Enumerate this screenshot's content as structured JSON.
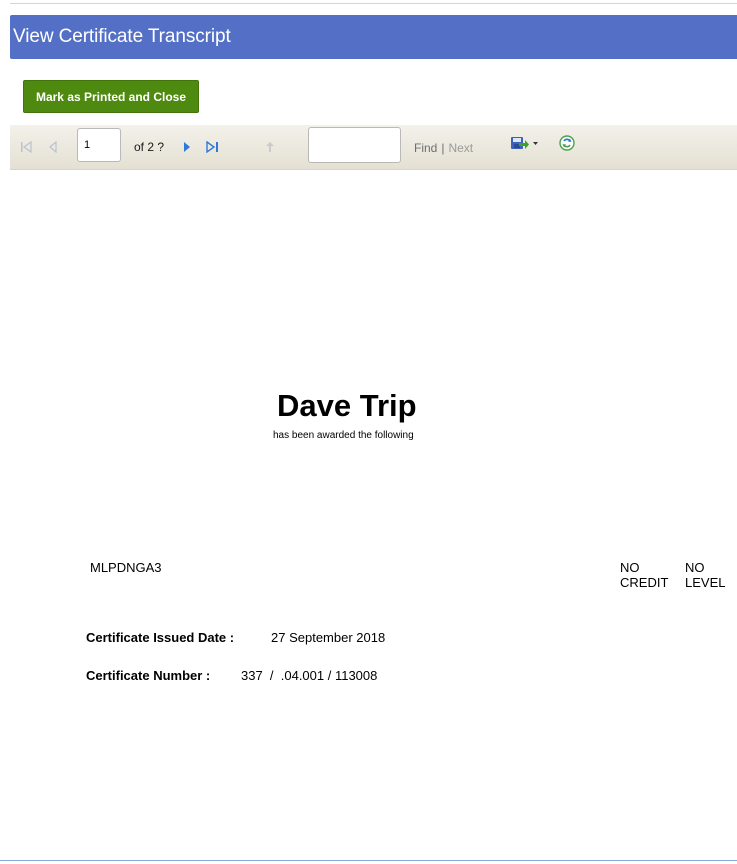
{
  "header": {
    "title": "View Certificate Transcript"
  },
  "actions": {
    "mark_printed_label": "Mark as Printed and Close"
  },
  "toolbar": {
    "page_value": "1",
    "page_of": "of 2 ?",
    "find_value": "",
    "find_label": "Find",
    "separator": "|",
    "next_label": "Next",
    "icons": [
      "first-page-icon",
      "previous-page-icon",
      "next-page-icon",
      "last-page-icon",
      "back-icon",
      "export-icon",
      "refresh-icon"
    ]
  },
  "report": {
    "recipient_name": "Dave Trip",
    "awarded_text": "has been awarded the following",
    "unit_code": "MLPDNGA3",
    "credit_text": "NO CREDIT",
    "level_text": "NO LEVEL",
    "issued_date_label": "Certificate Issued Date :",
    "issued_date_value": "27 September 2018",
    "certificate_number_label": "Certificate Number :",
    "certificate_number_value": "337  /  .04.001 / 113008"
  },
  "colors": {
    "header_bg": "#5470c6",
    "button_bg": "#4f8a10",
    "toolbar_bg": "#ece9df"
  }
}
